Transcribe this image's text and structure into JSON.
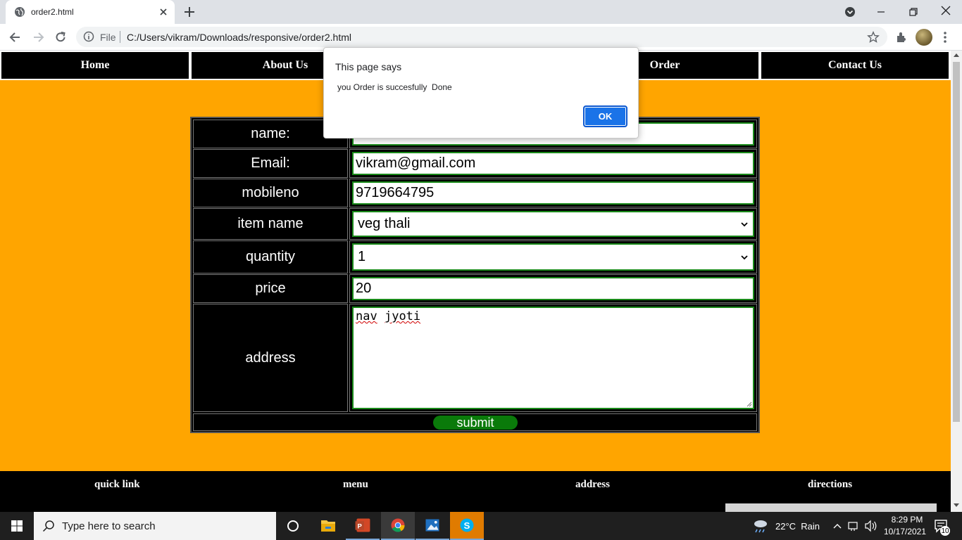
{
  "browser": {
    "tab_title": "order2.html",
    "scheme_label": "File",
    "url": "C:/Users/vikram/Downloads/responsive/order2.html"
  },
  "nav": {
    "items": [
      "Home",
      "About Us",
      "Order",
      "Contact Us"
    ]
  },
  "form": {
    "labels": {
      "name": "name:",
      "email": "Email:",
      "mobile": "mobileno",
      "item": "item name",
      "quantity": "quantity",
      "price": "price",
      "address": "address"
    },
    "values": {
      "name": "",
      "email": "vikram@gmail.com",
      "mobile": "9719664795",
      "item": "veg thali",
      "quantity": "1",
      "price": "20",
      "address_word1": "nav",
      "address_word2": "jyoti"
    },
    "submit_label": "submit"
  },
  "footer": {
    "items": [
      "quick link",
      "menu",
      "address",
      "directions"
    ]
  },
  "dialog": {
    "title": "This page says",
    "message": "you Order is succesfully  Done",
    "ok_label": "OK"
  },
  "taskbar": {
    "search_placeholder": "Type here to search",
    "weather": "22°C  Rain",
    "time": "8:29 PM",
    "date": "10/17/2021",
    "notification_count": "10"
  },
  "colors": {
    "page_bg": "#ffa500",
    "nav_bg": "#000000",
    "submit_bg": "#0a7a0a",
    "field_border": "#1a8a1a",
    "dialog_ok": "#1a73e8"
  }
}
